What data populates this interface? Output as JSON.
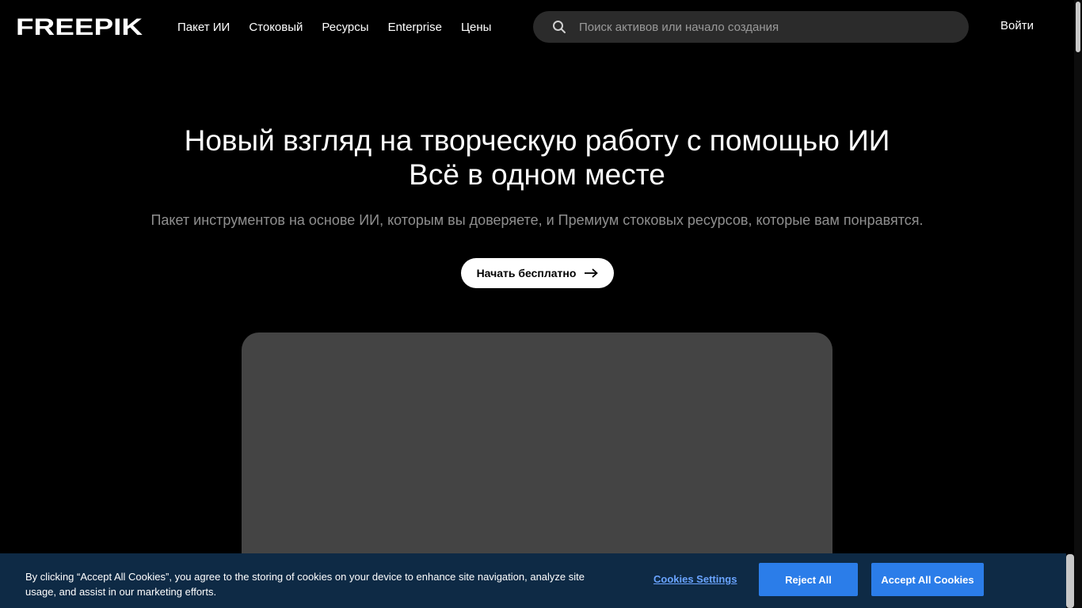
{
  "header": {
    "logo_text": "FREEPIK",
    "nav": [
      {
        "label": "Пакет ИИ"
      },
      {
        "label": "Стоковый"
      },
      {
        "label": "Ресурсы"
      },
      {
        "label": "Enterprise"
      },
      {
        "label": "Цены"
      }
    ],
    "search": {
      "placeholder": "Поиск активов или начало создания",
      "icon": "search-icon"
    },
    "login_label": "Войти"
  },
  "hero": {
    "title_line1": "Новый взгляд на творческую работу с помощью ИИ",
    "title_line2": "Всё в одном месте",
    "subtitle": "Пакет инструментов на основе ИИ, которым вы доверяете, и Премиум стоковых ресурсов, которые вам понравятся.",
    "cta_label": "Начать бесплатно",
    "cta_icon": "arrow-right-icon"
  },
  "cookie_banner": {
    "text": "By clicking “Accept All Cookies”, you agree to the storing of cookies on your device to enhance site navigation, analyze site usage, and assist in our marketing efforts.",
    "settings_label": "Cookies Settings",
    "reject_label": "Reject All",
    "accept_label": "Accept All Cookies"
  },
  "colors": {
    "background": "#000000",
    "search_bg": "#2b2b2b",
    "media_placeholder": "#444444",
    "cookie_bg": "#0e2a45",
    "cookie_button": "#2b7de9",
    "cookie_link": "#6aa4ff"
  }
}
